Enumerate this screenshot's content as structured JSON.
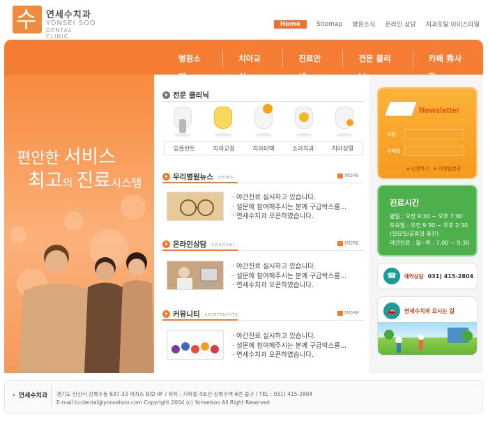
{
  "header": {
    "logo_glyph": "수",
    "logo_korean": "연세수치과",
    "logo_english_1": "YONSEI SOO",
    "logo_english_2": "DENTAL CLINIC",
    "topnav": [
      "Home",
      "Sitemap",
      "병원소식",
      "온라인 상담",
      "치과포탈 아이스마일"
    ]
  },
  "mainnav": [
    "병원소개",
    "치아교실",
    "진료안내",
    "전문 클리닉",
    "카페 秀사랑"
  ],
  "hero": {
    "slogan_line1_a": "편안한 ",
    "slogan_line1_b": "서비스",
    "slogan_line2_a": "최고",
    "slogan_line2_b": "의 ",
    "slogan_line2_c": "진료",
    "slogan_line2_d": "시스템"
  },
  "clinic": {
    "title": "전문 클리닉",
    "tabs": [
      "임플란트",
      "치아교정",
      "치아미백",
      "소아치과",
      "치아성형"
    ]
  },
  "news": {
    "title": "우리병원뉴스",
    "sub": "news",
    "more": "MORE",
    "items": [
      "야간진료 실시하고 있습니다.",
      "설문에 참여해주시는 분께 구급박스를...",
      "연세수치과 오픈하였습니다."
    ]
  },
  "counsel": {
    "title": "온라인상담",
    "sub": "counsel",
    "more": "MORE",
    "items": [
      "야간진료 실시하고 있습니다.",
      "설문에 참여해주시는 분께 구급박스를...",
      "연세수치과 오픈하였습니다."
    ]
  },
  "community": {
    "title": "커뮤니티",
    "sub": "community",
    "more": "MORE",
    "items": [
      "야간진료 실시하고 있습니다.",
      "설문에 참여해주시는 분께 구급박스를...",
      "연세수치과 오픈하였습니다."
    ]
  },
  "newsletter": {
    "title": "Newsletter",
    "name_label": "이름",
    "email_label": "이메일",
    "subscribe": "신청하기",
    "change": "이메일변경"
  },
  "hours": {
    "title": "진료시간",
    "lines": [
      "평일 : 오전 9:30 ~ 오후 7:00",
      "토요일 : 오전 9:30 ~ 오후 2:30",
      "(일요일/공휴일 휴진)",
      "야간진료 : 월~목 : 7:00 ~ 9:30"
    ]
  },
  "phone": {
    "label": "예약상담",
    "number": "031) 415-2804"
  },
  "directions": {
    "label": "연세수치과 오시는 길"
  },
  "footer": {
    "name": "연세수치과",
    "address": "경기도 안산시 상록수동 637-33 리치스 B/D 4F / 위치 : 지하철 4호선 상록수역 6번 출구 / TEL : 031) 415-2804",
    "copyright": "E-mail to:dental@yonseisoo.com   Copyright 2004 (c) Yonseisoo All Right Reserved"
  },
  "colors": {
    "brand_orange": "#f47c33",
    "green": "#4db04c",
    "yellow": "#fbb33a",
    "teal": "#199d9a"
  }
}
